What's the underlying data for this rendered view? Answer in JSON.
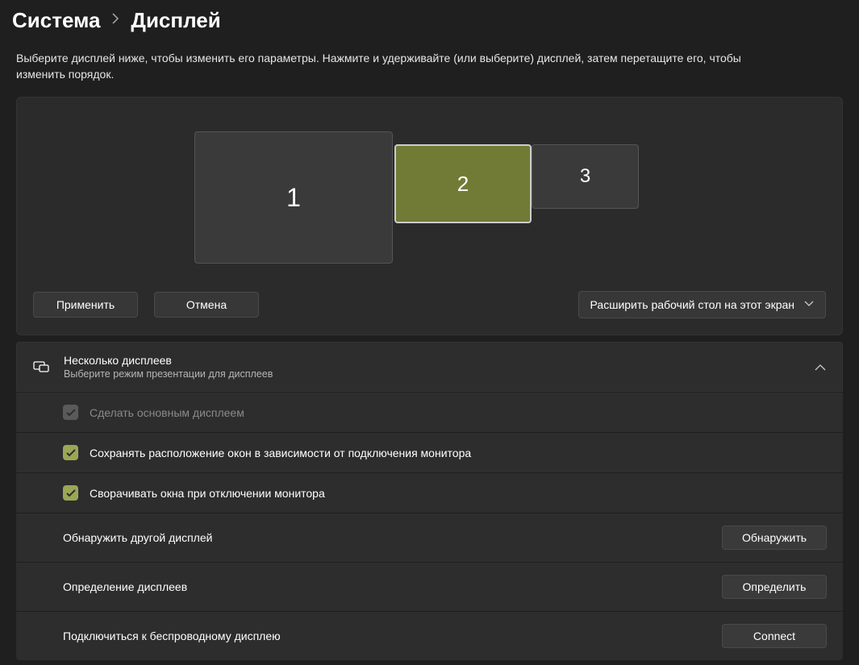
{
  "breadcrumb": {
    "parent": "Система",
    "current": "Дисплей"
  },
  "description": "Выберите дисплей ниже, чтобы изменить его параметры. Нажмите и удерживайте (или выберите) дисплей, затем перетащите его, чтобы изменить порядок.",
  "displays": {
    "d1": "1",
    "d2": "2",
    "d3": "3"
  },
  "buttons": {
    "apply": "Применить",
    "cancel": "Отмена"
  },
  "extend_dropdown": {
    "selected": "Расширить рабочий стол на этот экран"
  },
  "section": {
    "title": "Несколько дисплеев",
    "subtitle": "Выберите режим презентации для дисплеев"
  },
  "options": {
    "make_main": "Сделать основным дисплеем",
    "remember_windows": "Сохранять расположение окон в зависимости от подключения монитора",
    "minimize_on_disconnect": "Сворачивать окна при отключении монитора"
  },
  "actions": {
    "detect_other": "Обнаружить другой дисплей",
    "detect_btn": "Обнаружить",
    "identify": "Определение дисплеев",
    "identify_btn": "Определить",
    "wireless": "Подключиться к беспроводному дисплею",
    "wireless_btn": "Connect"
  }
}
